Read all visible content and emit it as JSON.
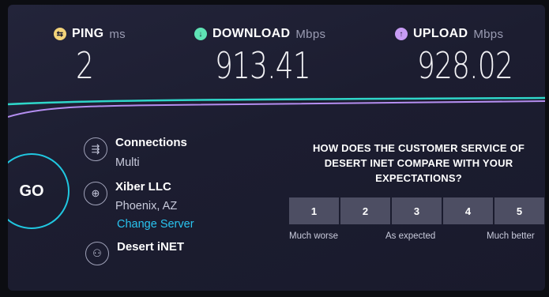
{
  "metrics": {
    "ping": {
      "label": "PING",
      "unit": "ms",
      "value": "2"
    },
    "download": {
      "label": "DOWNLOAD",
      "unit": "Mbps",
      "value": "913.41"
    },
    "upload": {
      "label": "UPLOAD",
      "unit": "Mbps",
      "value": "928.02"
    }
  },
  "go_label": "GO",
  "connections": {
    "label": "Connections",
    "value": "Multi"
  },
  "server": {
    "name": "Xiber LLC",
    "location": "Phoenix, AZ",
    "change_label": "Change Server"
  },
  "provider": {
    "name": "Desert iNET"
  },
  "survey": {
    "question": "HOW DOES THE CUSTOMER SERVICE OF DESERT INET COMPARE WITH YOUR EXPECTATIONS?",
    "options": [
      "1",
      "2",
      "3",
      "4",
      "5"
    ],
    "labels": {
      "low": "Much worse",
      "mid": "As expected",
      "high": "Much better"
    }
  },
  "colors": {
    "ping": "#f3d37a",
    "download": "#5fe3b5",
    "upload": "#c79cf4",
    "accent": "#20c7e0",
    "link": "#29c4f0"
  }
}
